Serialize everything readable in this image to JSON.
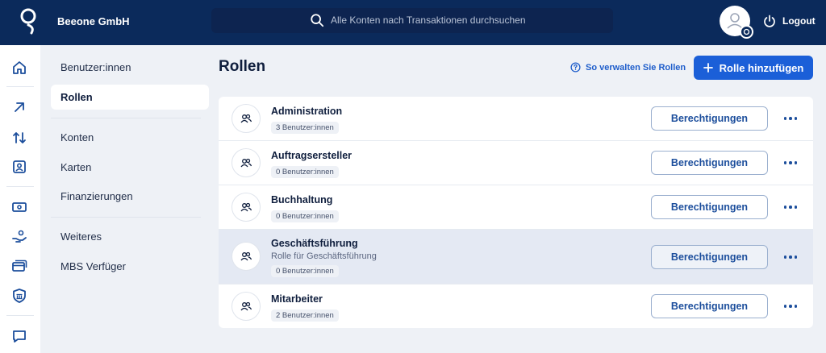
{
  "header": {
    "company": "Beeone GmbH",
    "search_placeholder": "Alle Konten nach Transaktionen durchsuchen",
    "logout_label": "Logout"
  },
  "rail": {
    "icons": [
      "home-icon",
      "arrow-up-right-icon",
      "transfer-arrows-icon",
      "contact-card-icon",
      "banknote-icon",
      "hand-coin-icon",
      "cards-icon",
      "bank-shield-icon",
      "chat-icon"
    ]
  },
  "subnav": {
    "items": [
      {
        "label": "Benutzer:innen"
      },
      {
        "label": "Rollen"
      },
      {
        "label": "Konten"
      },
      {
        "label": "Karten"
      },
      {
        "label": "Finanzierungen"
      },
      {
        "label": "Weiteres"
      },
      {
        "label": "MBS Verfüger"
      }
    ],
    "active": "Rollen"
  },
  "main": {
    "title": "Rollen",
    "help_link": "So verwalten Sie Rollen",
    "add_button": "Rolle hinzufügen",
    "roles": [
      {
        "name": "Administration",
        "description": "",
        "users": "3 Benutzer:innen",
        "permissions_label": "Berechtigungen"
      },
      {
        "name": "Auftragsersteller",
        "description": "",
        "users": "0 Benutzer:innen",
        "permissions_label": "Berechtigungen"
      },
      {
        "name": "Buchhaltung",
        "description": "",
        "users": "0 Benutzer:innen",
        "permissions_label": "Berechtigungen"
      },
      {
        "name": "Geschäftsführung",
        "description": "Rolle für Geschäftsführung",
        "users": "0 Benutzer:innen",
        "permissions_label": "Berechtigungen"
      },
      {
        "name": "Mitarbeiter",
        "description": "",
        "users": "2 Benutzer:innen",
        "permissions_label": "Berechtigungen"
      }
    ]
  },
  "colors": {
    "topbar": "#0b2a5b",
    "accent": "#1b5fd8",
    "link": "#1f5ecb",
    "page_bg": "#eef1f6",
    "row_highlight": "#e4e9f3"
  }
}
